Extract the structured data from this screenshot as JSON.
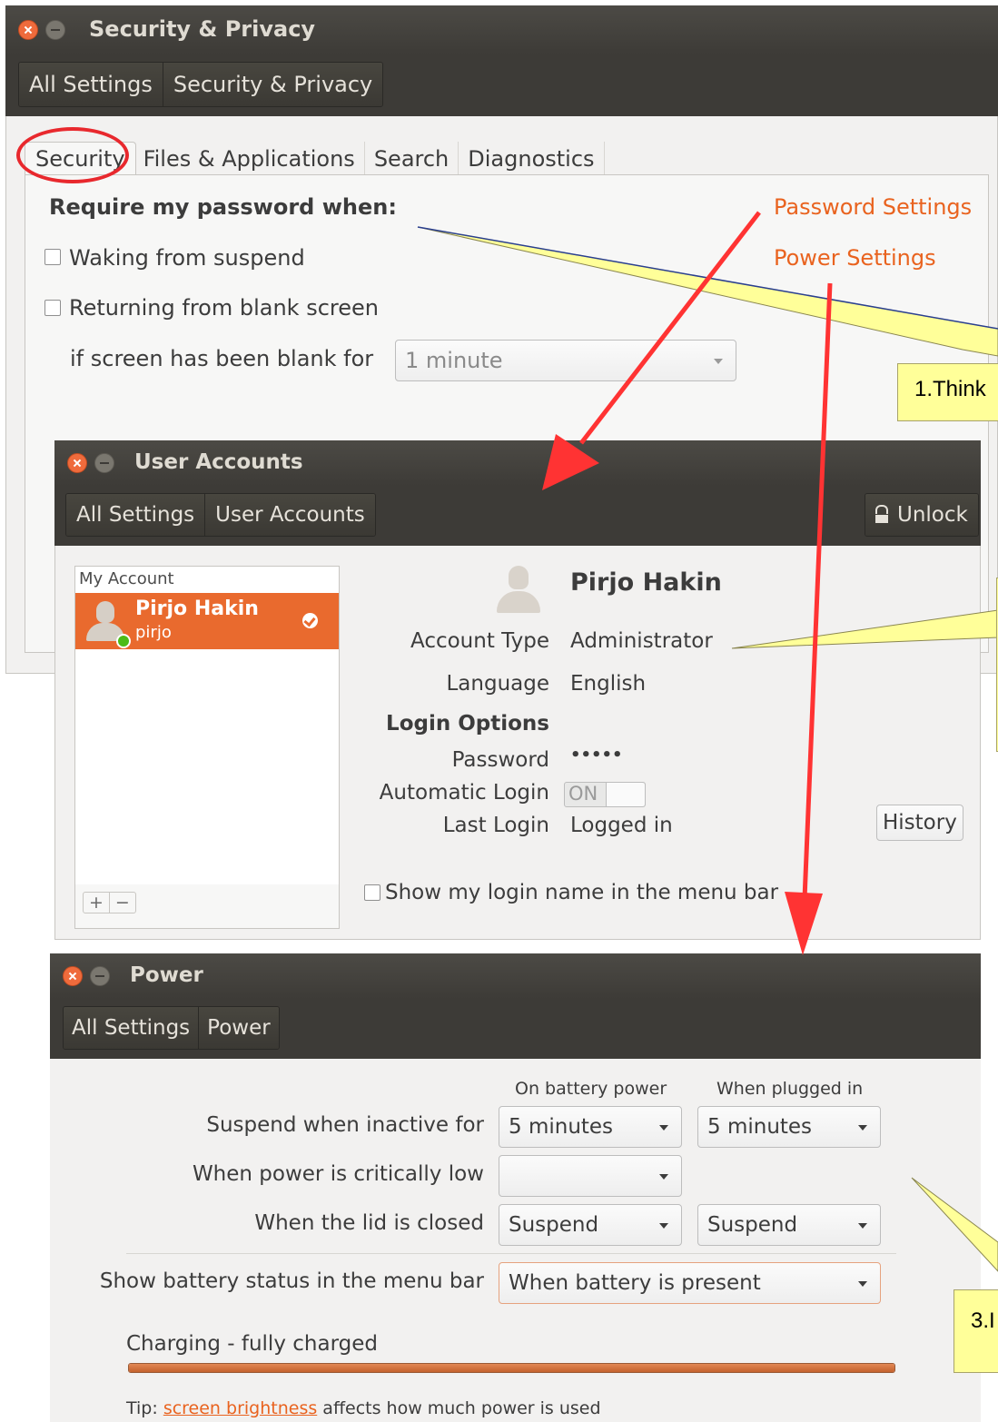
{
  "security_window": {
    "title": "Security & Privacy",
    "breadcrumbs": [
      "All Settings",
      "Security & Privacy"
    ],
    "tabs": [
      "Security",
      "Files & Applications",
      "Search",
      "Diagnostics"
    ],
    "require_heading": "Require my password when:",
    "options": [
      "Waking from suspend",
      "Returning from blank screen"
    ],
    "blank_label": "if screen has been blank for",
    "blank_value": "1 minute",
    "password_settings_link": "Password Settings",
    "power_settings_link": "Power Settings"
  },
  "user_accounts_window": {
    "title": "User Accounts",
    "breadcrumbs": [
      "All Settings",
      "User Accounts"
    ],
    "unlock_label": "Unlock",
    "list_header": "My Account",
    "selected_user_name": "Pirjo Hakin",
    "selected_user_login": "pirjo",
    "add_remove": [
      "+",
      "−"
    ],
    "user_full_name": "Pirjo Hakin",
    "fields": [
      {
        "label": "Account Type",
        "value": "Administrator"
      },
      {
        "label": "Language",
        "value": "English"
      }
    ],
    "login_options_heading": "Login Options",
    "password_label": "Password",
    "password_value": "•••••",
    "auto_login_label": "Automatic Login",
    "auto_login_state": "ON",
    "last_login_label": "Last Login",
    "last_login_value": "Logged in",
    "history_button": "History",
    "show_login_name": "Show my login name in the menu bar"
  },
  "power_window": {
    "title": "Power",
    "breadcrumbs": [
      "All Settings",
      "Power"
    ],
    "col_battery": "On battery power",
    "col_plugged": "When plugged in",
    "rows": [
      {
        "label": "Suspend when inactive for",
        "battery": "5 minutes",
        "plugged": "5 minutes"
      },
      {
        "label": "When power is critically low",
        "battery": "",
        "plugged": null
      },
      {
        "label": "When the lid is closed",
        "battery": "Suspend",
        "plugged": "Suspend"
      }
    ],
    "battery_status_label": "Show battery status in the menu bar",
    "battery_status_value": "When battery is present",
    "charging_label": "Charging - fully charged",
    "charge_level_percent": 100,
    "tip_prefix": "Tip:",
    "tip_link": "screen brightness",
    "tip_suffix": "affects how much power is used"
  },
  "annotations": {
    "callout_1": "1.Think",
    "callout_3": "3.I",
    "arrow_color": "#ff3333",
    "callout_color": "#ffff99",
    "highlight_circle_color": "#e8282d"
  }
}
